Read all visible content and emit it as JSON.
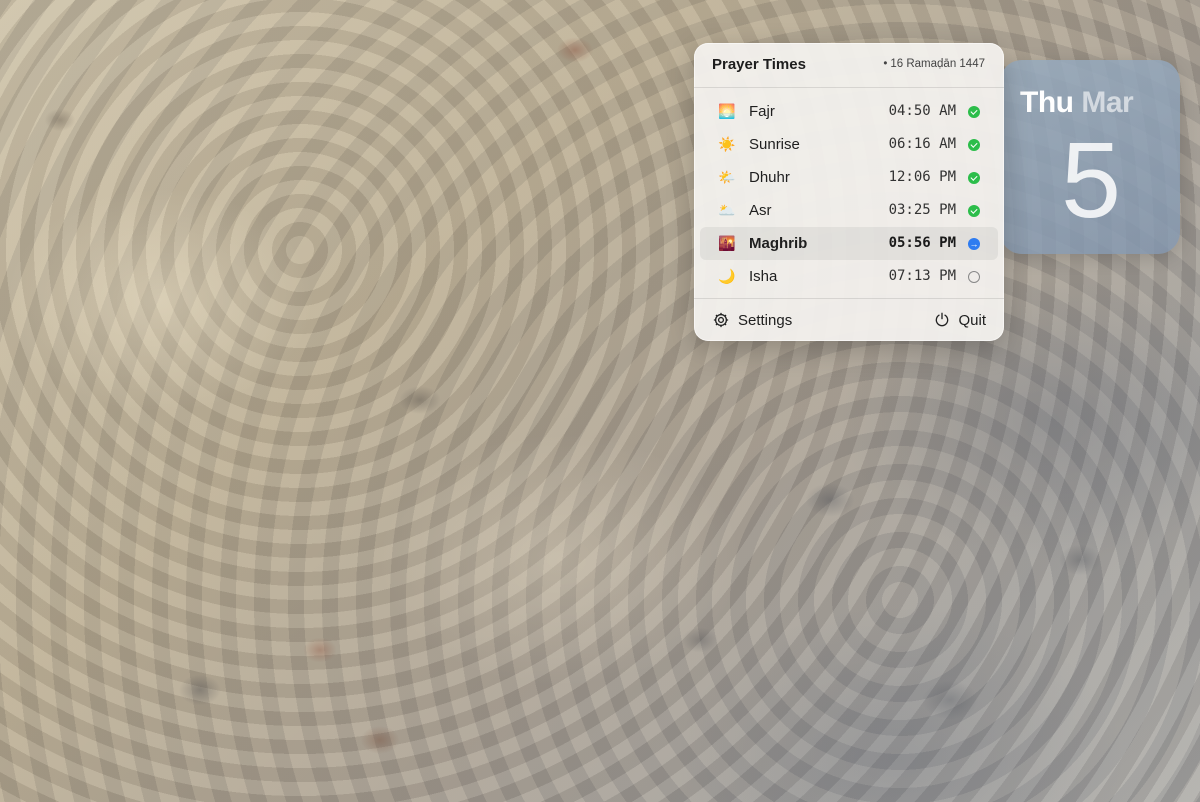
{
  "panel": {
    "title": "Prayer Times",
    "hijri_date": "16 Ramaḍān 1447",
    "prayers": [
      {
        "emoji": "🌅",
        "icon": "fajr-icon",
        "name": "Fajr",
        "time": "04:50 AM",
        "status": "done"
      },
      {
        "emoji": "☀️",
        "icon": "sunrise-icon",
        "name": "Sunrise",
        "time": "06:16 AM",
        "status": "done"
      },
      {
        "emoji": "🌤️",
        "icon": "dhuhr-icon",
        "name": "Dhuhr",
        "time": "12:06 PM",
        "status": "done"
      },
      {
        "emoji": "🌥️",
        "icon": "asr-icon",
        "name": "Asr",
        "time": "03:25 PM",
        "status": "done"
      },
      {
        "emoji": "🌇",
        "icon": "maghrib-icon",
        "name": "Maghrib",
        "time": "05:56 PM",
        "status": "next"
      },
      {
        "emoji": "🌙",
        "icon": "isha-icon",
        "name": "Isha",
        "time": "07:13 PM",
        "status": "pending"
      }
    ],
    "footer": {
      "settings_label": "Settings",
      "quit_label": "Quit"
    }
  },
  "calendar_widget": {
    "weekday": "Thu",
    "month": "Mar",
    "day": "5"
  },
  "colors": {
    "done": "#2cbd4a",
    "next": "#2f7cf0",
    "widget_bg": "#8fa6bd"
  }
}
